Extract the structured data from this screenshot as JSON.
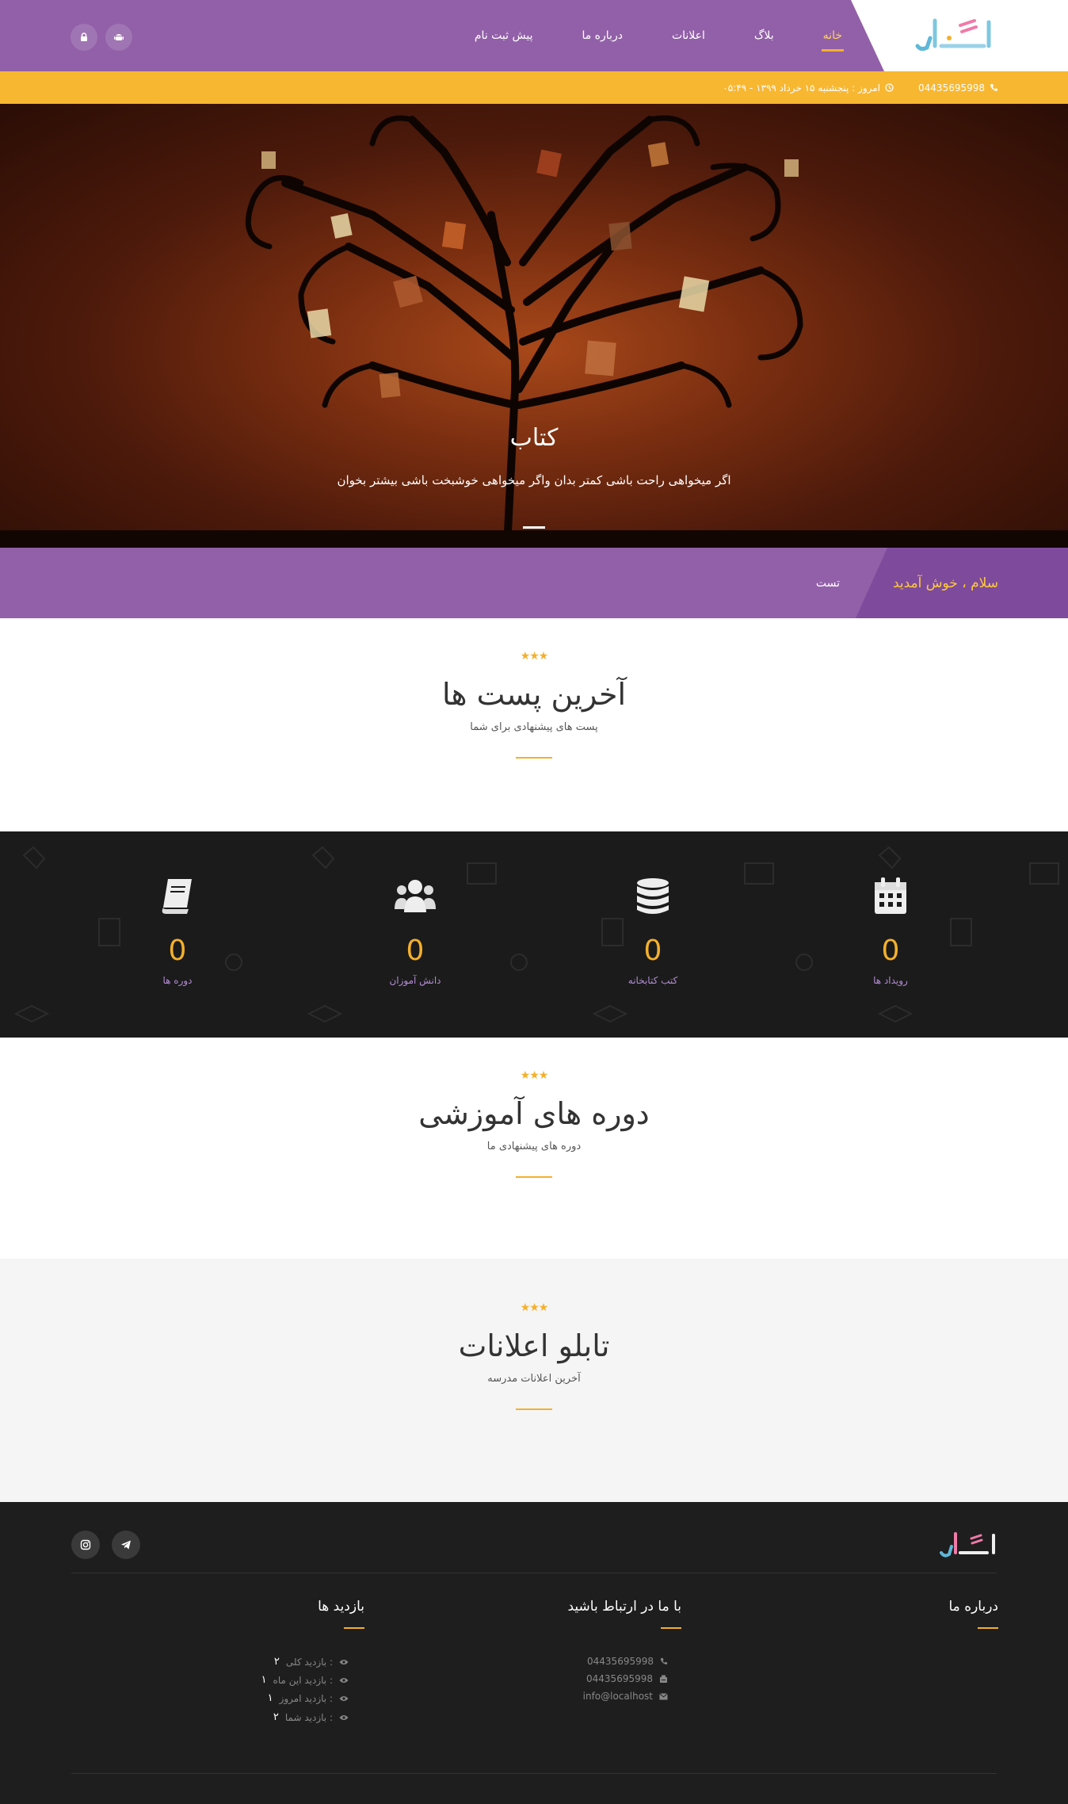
{
  "header": {
    "logo_text": "اکـو",
    "nav": [
      "خانه",
      "بلاگ",
      "اعلانات",
      "درباره ما",
      "پیش ثبت نام"
    ],
    "icons": [
      "lock-icon",
      "android-icon"
    ]
  },
  "topbar": {
    "phone": "04435695998",
    "date": "امروز : پنجشنبه ۱۵ خرداد ۱۳۹۹ - ۰۵:۴۹"
  },
  "hero": {
    "title": "کتاب",
    "subtitle": "اگر میخواهی راحت باشی کمتر بدان واگر میخواهی خوشبخت باشی بیشتر بخوان"
  },
  "welcome": {
    "greeting": "سلام ، خوش آمدید",
    "ticker": "تست"
  },
  "sections": {
    "posts": {
      "title": "آخرین پست ها",
      "subtitle": "پست های پیشنهادی برای شما"
    },
    "courses": {
      "title": "دوره های آموزشی",
      "subtitle": "دوره های پیشنهادی ما"
    },
    "notices": {
      "title": "تابلو اعلانات",
      "subtitle": "آخرین اعلانات مدرسه"
    }
  },
  "stats": [
    {
      "icon": "calendar-icon",
      "value": "0",
      "label": "رویداد ها"
    },
    {
      "icon": "database-icon",
      "value": "0",
      "label": "کتب کتابخانه"
    },
    {
      "icon": "users-icon",
      "value": "0",
      "label": "دانش آموزان"
    },
    {
      "icon": "book-icon",
      "value": "0",
      "label": "دوره ها"
    }
  ],
  "footer": {
    "logo_text": "اکـو",
    "social": [
      "telegram-icon",
      "instagram-icon"
    ],
    "about": {
      "title": "درباره ما"
    },
    "contact": {
      "title": "با ما در ارتباط باشید",
      "phone": "04435695998",
      "fax": "04435695998",
      "email": "info@localhost"
    },
    "visits": {
      "title": "بازدید ها",
      "rows": [
        {
          "label": "بازدید کلی :",
          "value": "۲"
        },
        {
          "label": "بازدید این ماه :",
          "value": "۱"
        },
        {
          "label": "بازدید امروز :",
          "value": "۱"
        },
        {
          "label": "بازدید شما :",
          "value": "۲"
        }
      ]
    }
  },
  "colors": {
    "purple": "#9260a8",
    "orange": "#f8b731",
    "dark": "#1b1b1b",
    "stat_label": "#b38cd4"
  }
}
